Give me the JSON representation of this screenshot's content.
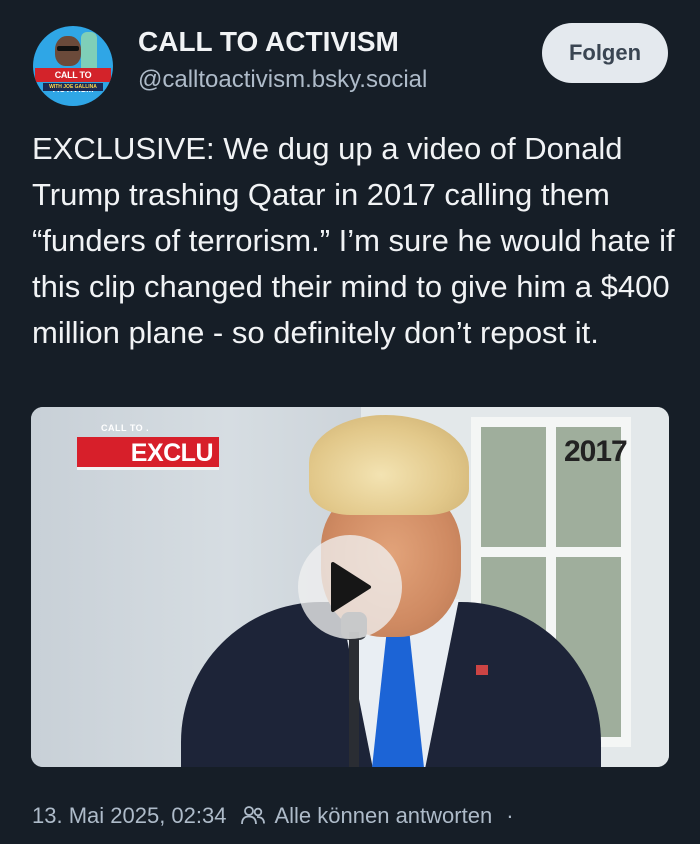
{
  "author": {
    "display_name": "CALL TO ACTIVISM",
    "handle": "@calltoactivism.bsky.social",
    "avatar_banner": "CALL TO ACTIVISM",
    "avatar_sub": "WITH JOE GALLINA"
  },
  "follow_button": {
    "label": "Folgen"
  },
  "post": {
    "text": "EXCLUSIVE: We dug up a video of Donald Trump trashing Qatar in 2017 calling them “funders of terrorism.” I’m sure he would hate if this clip changed their mind to give him a $400 million plane - so definitely don’t repost it."
  },
  "video": {
    "overlay_small": "CALL TO .",
    "overlay_badge": "EXCLU",
    "overlay_year": "2017",
    "badge_color": "#d71f2a"
  },
  "footer": {
    "timestamp": "13. Mai 2025, 02:34",
    "reply_setting": "Alle können antworten",
    "separator": "·",
    "reply_icon": "people-icon"
  },
  "colors": {
    "background": "#161e27",
    "text_primary": "#f1f3f5",
    "text_secondary": "#aebbc9",
    "button_bg": "#e4e9ee"
  }
}
